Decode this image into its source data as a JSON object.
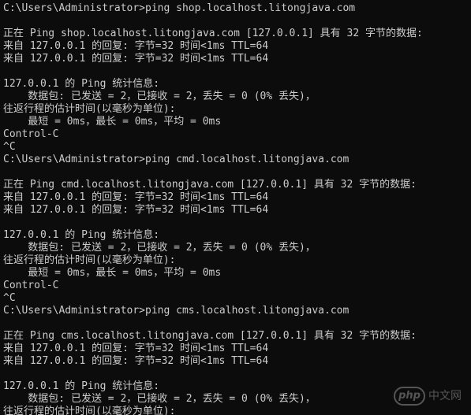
{
  "console": {
    "lines": [
      "C:\\Users\\Administrator>ping shop.localhost.litongjava.com",
      "",
      "正在 Ping shop.localhost.litongjava.com [127.0.0.1] 具有 32 字节的数据:",
      "来自 127.0.0.1 的回复: 字节=32 时间<1ms TTL=64",
      "来自 127.0.0.1 的回复: 字节=32 时间<1ms TTL=64",
      "",
      "127.0.0.1 的 Ping 统计信息:",
      "    数据包: 已发送 = 2，已接收 = 2，丢失 = 0 (0% 丢失)，",
      "往返行程的估计时间(以毫秒为单位):",
      "    最短 = 0ms，最长 = 0ms，平均 = 0ms",
      "Control-C",
      "^C",
      "C:\\Users\\Administrator>ping cmd.localhost.litongjava.com",
      "",
      "正在 Ping cmd.localhost.litongjava.com [127.0.0.1] 具有 32 字节的数据:",
      "来自 127.0.0.1 的回复: 字节=32 时间<1ms TTL=64",
      "来自 127.0.0.1 的回复: 字节=32 时间<1ms TTL=64",
      "",
      "127.0.0.1 的 Ping 统计信息:",
      "    数据包: 已发送 = 2，已接收 = 2，丢失 = 0 (0% 丢失)，",
      "往返行程的估计时间(以毫秒为单位):",
      "    最短 = 0ms，最长 = 0ms，平均 = 0ms",
      "Control-C",
      "^C",
      "C:\\Users\\Administrator>ping cms.localhost.litongjava.com",
      "",
      "正在 Ping cms.localhost.litongjava.com [127.0.0.1] 具有 32 字节的数据:",
      "来自 127.0.0.1 的回复: 字节=32 时间<1ms TTL=64",
      "来自 127.0.0.1 的回复: 字节=32 时间<1ms TTL=64",
      "",
      "127.0.0.1 的 Ping 统计信息:",
      "    数据包: 已发送 = 2，已接收 = 2，丢失 = 0 (0% 丢失)，",
      "往返行程的估计时间(以毫秒为单位):"
    ]
  },
  "watermark": {
    "badge": "php",
    "text": "中文网"
  },
  "colors": {
    "background": "#0c0c0c",
    "text": "#cccccc"
  }
}
